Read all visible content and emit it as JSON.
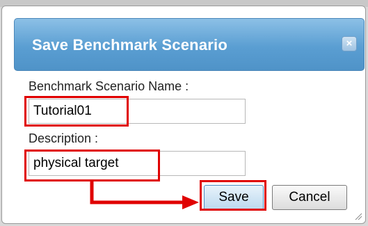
{
  "dialog": {
    "title": "Save Benchmark Scenario",
    "close_icon": "close-icon",
    "close_glyph": "×"
  },
  "form": {
    "name_label": "Benchmark Scenario Name :",
    "name_value": "Tutorial01",
    "description_label": "Description :",
    "description_value": "physical target"
  },
  "buttons": {
    "save_label": "Save",
    "cancel_label": "Cancel"
  },
  "annotations": {
    "highlight_color": "#e00000",
    "arrow_icon": "red-arrow-icon"
  }
}
